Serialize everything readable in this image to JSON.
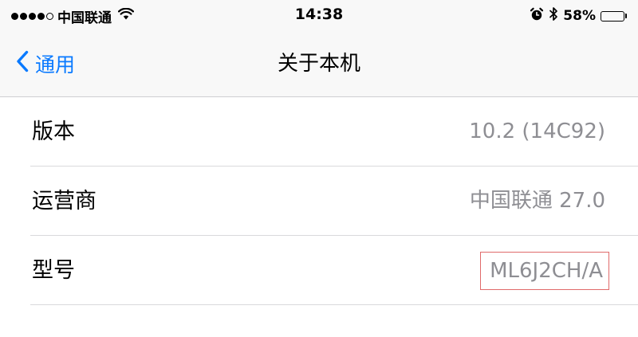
{
  "status_bar": {
    "carrier": "中国联通",
    "time": "14:38",
    "battery_percent_text": "58%",
    "battery_level": 0.58,
    "icons": [
      "signal-dots-icon",
      "wifi-icon",
      "alarm-icon",
      "bluetooth-icon",
      "battery-icon"
    ]
  },
  "nav": {
    "back_label": "通用",
    "title": "关于本机"
  },
  "rows": [
    {
      "label": "版本",
      "value": "10.2 (14C92)"
    },
    {
      "label": "运营商",
      "value": "中国联通 27.0"
    },
    {
      "label": "型号",
      "value": "ML6J2CH/A"
    }
  ],
  "colors": {
    "accent": "#0a7aff",
    "value_text": "#8e8e93",
    "highlight_border": "#e06a6a",
    "background": "#f8f8f8"
  }
}
